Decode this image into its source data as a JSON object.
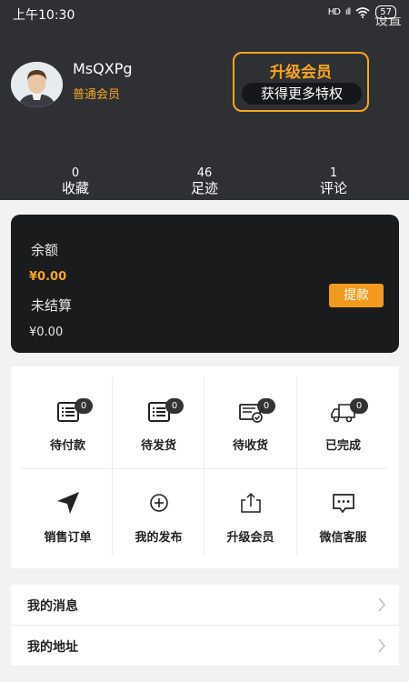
{
  "status_bar": {
    "time": "上午10:30",
    "network": "HD",
    "signal": "ıll",
    "battery": "57"
  },
  "header": {
    "settings_label": "设置",
    "username": "MsQXPg",
    "member_level": "普通会员",
    "upgrade": {
      "title": "升级会员",
      "subtitle": "获得更多特权"
    },
    "stats": [
      {
        "value": "0",
        "label": "收藏"
      },
      {
        "value": "46",
        "label": "足迹"
      },
      {
        "value": "1",
        "label": "评论"
      }
    ]
  },
  "balance": {
    "balance_label": "余额",
    "balance_value": "¥0.00",
    "unsettled_label": "未结算",
    "unsettled_value": "¥0.00",
    "withdraw_label": "提款"
  },
  "orders": [
    {
      "label": "待付款",
      "badge": "0",
      "icon": "list-icon"
    },
    {
      "label": "待发货",
      "badge": "0",
      "icon": "list-icon"
    },
    {
      "label": "待收货",
      "badge": "0",
      "icon": "package-icon"
    },
    {
      "label": "已完成",
      "badge": "0",
      "icon": "truck-icon"
    },
    {
      "label": "销售订单",
      "icon": "navigation-arrow-icon"
    },
    {
      "label": "我的发布",
      "icon": "plus-circle-icon"
    },
    {
      "label": "升级会员",
      "icon": "upload-icon"
    },
    {
      "label": "微信客服",
      "icon": "chat-icon"
    }
  ],
  "menu": [
    {
      "label": "我的消息"
    },
    {
      "label": "我的地址"
    }
  ],
  "colors": {
    "header_bg": "#2f3034",
    "accent": "#f5a623",
    "card_bg": "#1a1b1d"
  }
}
